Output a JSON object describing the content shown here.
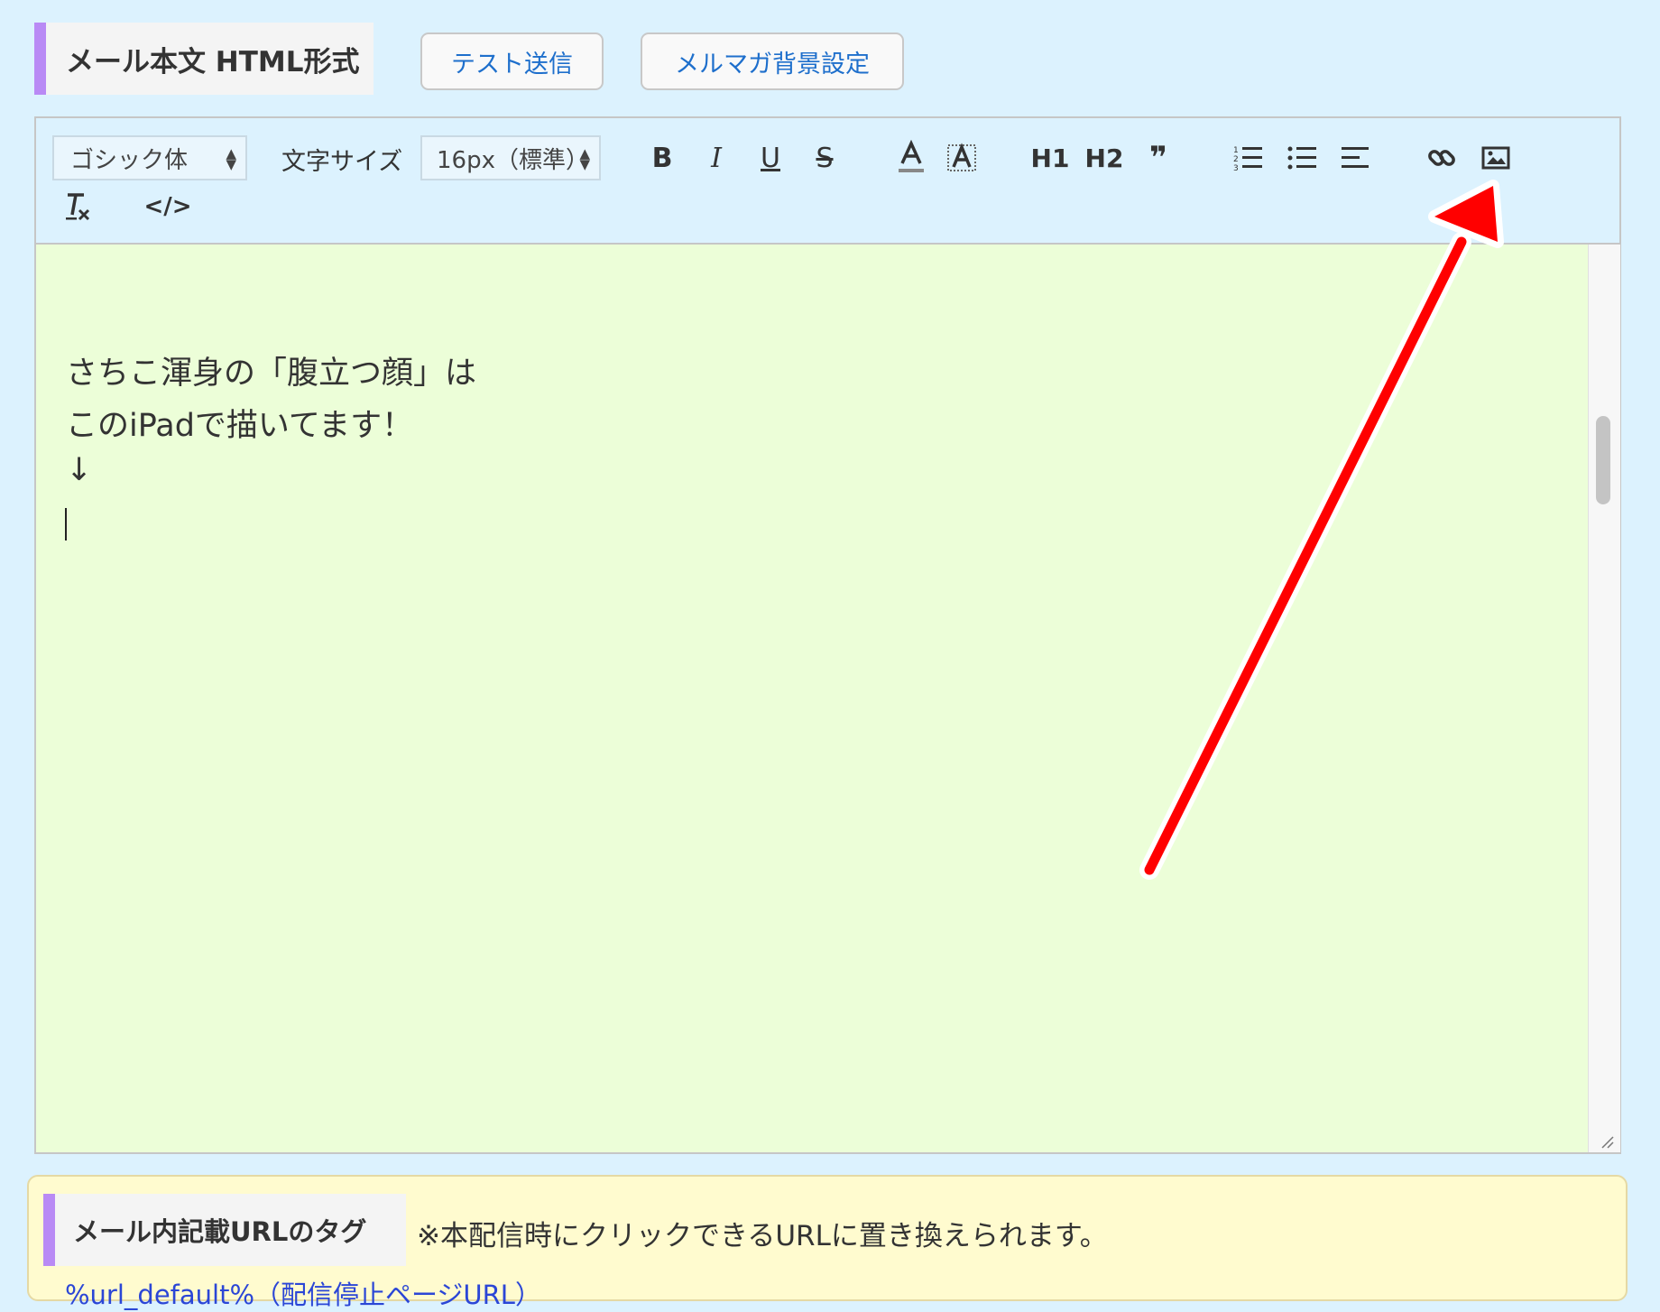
{
  "header": {
    "title": "メール本文 HTML形式",
    "test_send_label": "テスト送信",
    "background_settings_label": "メルマガ背景設定"
  },
  "toolbar": {
    "font_family_value": "ゴシック体",
    "font_size_label": "文字サイズ",
    "font_size_value": "16px（標準）",
    "bold": "B",
    "italic": "I",
    "underline": "U",
    "strike": "S",
    "h1": "H1",
    "h2": "H2",
    "quote": "❞",
    "code": "</>"
  },
  "editor": {
    "lines": [
      "さちこ渾身の「腹立つ顔」は",
      "このiPadで描いてます！",
      "↓"
    ]
  },
  "tag_section": {
    "title": "メール内記載URLのタグ",
    "note": "※本配信時にクリックできるURLに置き換えられます。",
    "link_text": "%url_default%（配信停止ページURL）"
  },
  "colors": {
    "page_background": "#dcf2fe",
    "editor_background": "#ecfed8",
    "accent_bar": "#b98af5",
    "annotation_arrow": "#ff0000",
    "tag_panel_background": "#fffbcf"
  }
}
